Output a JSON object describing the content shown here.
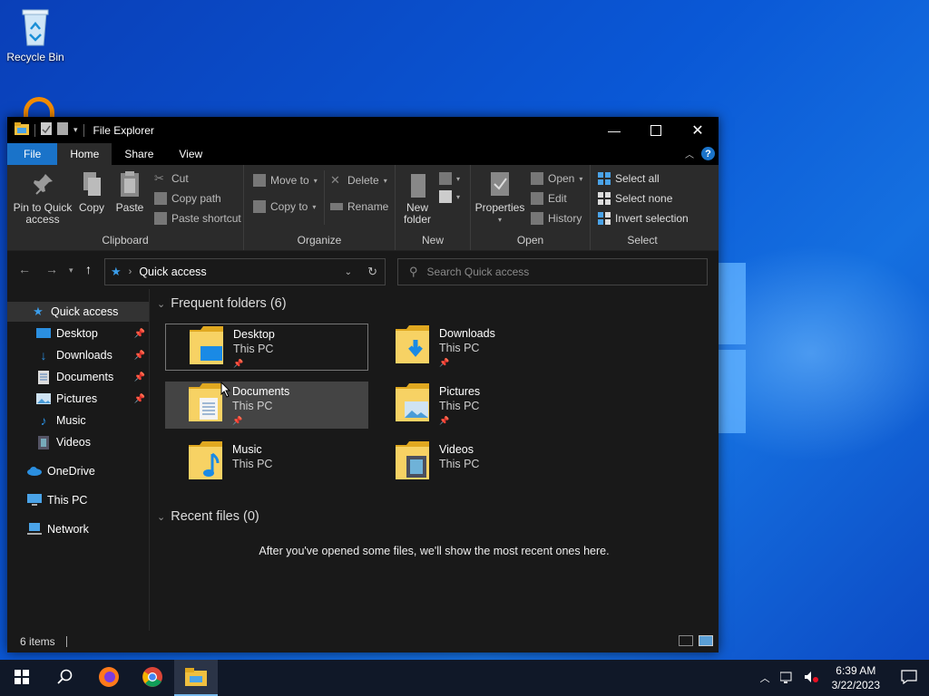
{
  "desktop": {
    "icons": [
      {
        "label": "Recycle Bin"
      }
    ]
  },
  "window": {
    "title": "File Explorer",
    "tabs": [
      "File",
      "Home",
      "Share",
      "View"
    ],
    "ribbon": {
      "clipboard": {
        "label": "Clipboard",
        "pin": [
          "Pin to Quick",
          "access"
        ],
        "copy": "Copy",
        "paste": "Paste",
        "cut": "Cut",
        "copy_path": "Copy path",
        "paste_shortcut": "Paste shortcut"
      },
      "organize": {
        "label": "Organize",
        "move_to": "Move to",
        "copy_to": "Copy to",
        "delete": "Delete",
        "rename": "Rename"
      },
      "new": {
        "label": "New",
        "new_folder": [
          "New",
          "folder"
        ]
      },
      "open": {
        "label": "Open",
        "properties": "Properties",
        "open": "Open",
        "edit": "Edit",
        "history": "History"
      },
      "select": {
        "label": "Select",
        "select_all": "Select all",
        "select_none": "Select none",
        "invert": "Invert selection"
      }
    },
    "address": {
      "location": "Quick access",
      "search_placeholder": "Search Quick access"
    },
    "sidebar": {
      "items": [
        {
          "label": "Quick access"
        },
        {
          "label": "Desktop"
        },
        {
          "label": "Downloads"
        },
        {
          "label": "Documents"
        },
        {
          "label": "Pictures"
        },
        {
          "label": "Music"
        },
        {
          "label": "Videos"
        },
        {
          "label": "OneDrive"
        },
        {
          "label": "This PC"
        },
        {
          "label": "Network"
        }
      ]
    },
    "content": {
      "frequent_title": "Frequent folders (6)",
      "folders": [
        {
          "name": "Desktop",
          "location": "This PC"
        },
        {
          "name": "Downloads",
          "location": "This PC"
        },
        {
          "name": "Documents",
          "location": "This PC"
        },
        {
          "name": "Pictures",
          "location": "This PC"
        },
        {
          "name": "Music",
          "location": "This PC"
        },
        {
          "name": "Videos",
          "location": "This PC"
        }
      ],
      "recent_title": "Recent files (0)",
      "recent_empty": "After you've opened some files, we'll show the most recent ones here."
    },
    "status": {
      "items": "6 items"
    }
  },
  "taskbar": {
    "time": "6:39 AM",
    "date": "3/22/2023"
  }
}
